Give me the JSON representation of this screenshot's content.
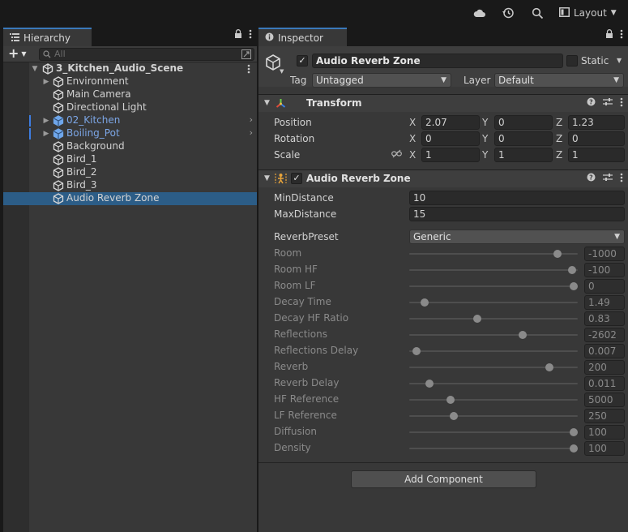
{
  "topbar": {
    "cloud_icon": "cloud-icon",
    "history_icon": "history-icon",
    "search_icon": "search-icon",
    "layout_label": "Layout"
  },
  "hierarchy": {
    "tab_label": "Hierarchy",
    "search_placeholder": "All",
    "scene_name": "3_Kitchen_Audio_Scene",
    "items": [
      {
        "label": "Environment",
        "foldout": true,
        "prefab": false
      },
      {
        "label": "Main Camera",
        "foldout": false,
        "prefab": false
      },
      {
        "label": "Directional Light",
        "foldout": false,
        "prefab": false
      },
      {
        "label": "02_Kitchen",
        "foldout": true,
        "prefab": true
      },
      {
        "label": "Boiling_Pot",
        "foldout": true,
        "prefab": true
      },
      {
        "label": "Background",
        "foldout": false,
        "prefab": false
      },
      {
        "label": "Bird_1",
        "foldout": false,
        "prefab": false
      },
      {
        "label": "Bird_2",
        "foldout": false,
        "prefab": false
      },
      {
        "label": "Bird_3",
        "foldout": false,
        "prefab": false
      },
      {
        "label": "Audio Reverb Zone",
        "foldout": false,
        "prefab": false,
        "selected": true
      }
    ]
  },
  "inspector": {
    "tab_label": "Inspector",
    "object_name": "Audio Reverb Zone",
    "static_label": "Static",
    "tag_label": "Tag",
    "tag_value": "Untagged",
    "layer_label": "Layer",
    "layer_value": "Default",
    "transform": {
      "title": "Transform",
      "position_label": "Position",
      "rotation_label": "Rotation",
      "scale_label": "Scale",
      "position": {
        "x": "2.07",
        "y": "0",
        "z": "1.23"
      },
      "rotation": {
        "x": "0",
        "y": "0",
        "z": "0"
      },
      "scale": {
        "x": "1",
        "y": "1",
        "z": "1"
      }
    },
    "reverb_zone": {
      "title": "Audio Reverb Zone",
      "min_distance_label": "MinDistance",
      "min_distance": "10",
      "max_distance_label": "MaxDistance",
      "max_distance": "15",
      "preset_label": "ReverbPreset",
      "preset_value": "Generic",
      "params": [
        {
          "label": "Room",
          "value": "-1000",
          "level": 0.9
        },
        {
          "label": "Room HF",
          "value": "-100",
          "level": 0.99
        },
        {
          "label": "Room LF",
          "value": "0",
          "level": 1.0
        },
        {
          "label": "Decay Time",
          "value": "1.49",
          "level": 0.07
        },
        {
          "label": "Decay HF Ratio",
          "value": "0.83",
          "level": 0.4
        },
        {
          "label": "Reflections",
          "value": "-2602",
          "level": 0.68
        },
        {
          "label": "Reflections Delay",
          "value": "0.007",
          "level": 0.02
        },
        {
          "label": "Reverb",
          "value": "200",
          "level": 0.85
        },
        {
          "label": "Reverb Delay",
          "value": "0.011",
          "level": 0.1
        },
        {
          "label": "HF Reference",
          "value": "5000",
          "level": 0.23
        },
        {
          "label": "LF Reference",
          "value": "250",
          "level": 0.25
        },
        {
          "label": "Diffusion",
          "value": "100",
          "level": 1.0
        },
        {
          "label": "Density",
          "value": "100",
          "level": 1.0
        }
      ]
    },
    "add_component_label": "Add Component"
  },
  "x_label": "X",
  "y_label": "Y",
  "z_label": "Z"
}
